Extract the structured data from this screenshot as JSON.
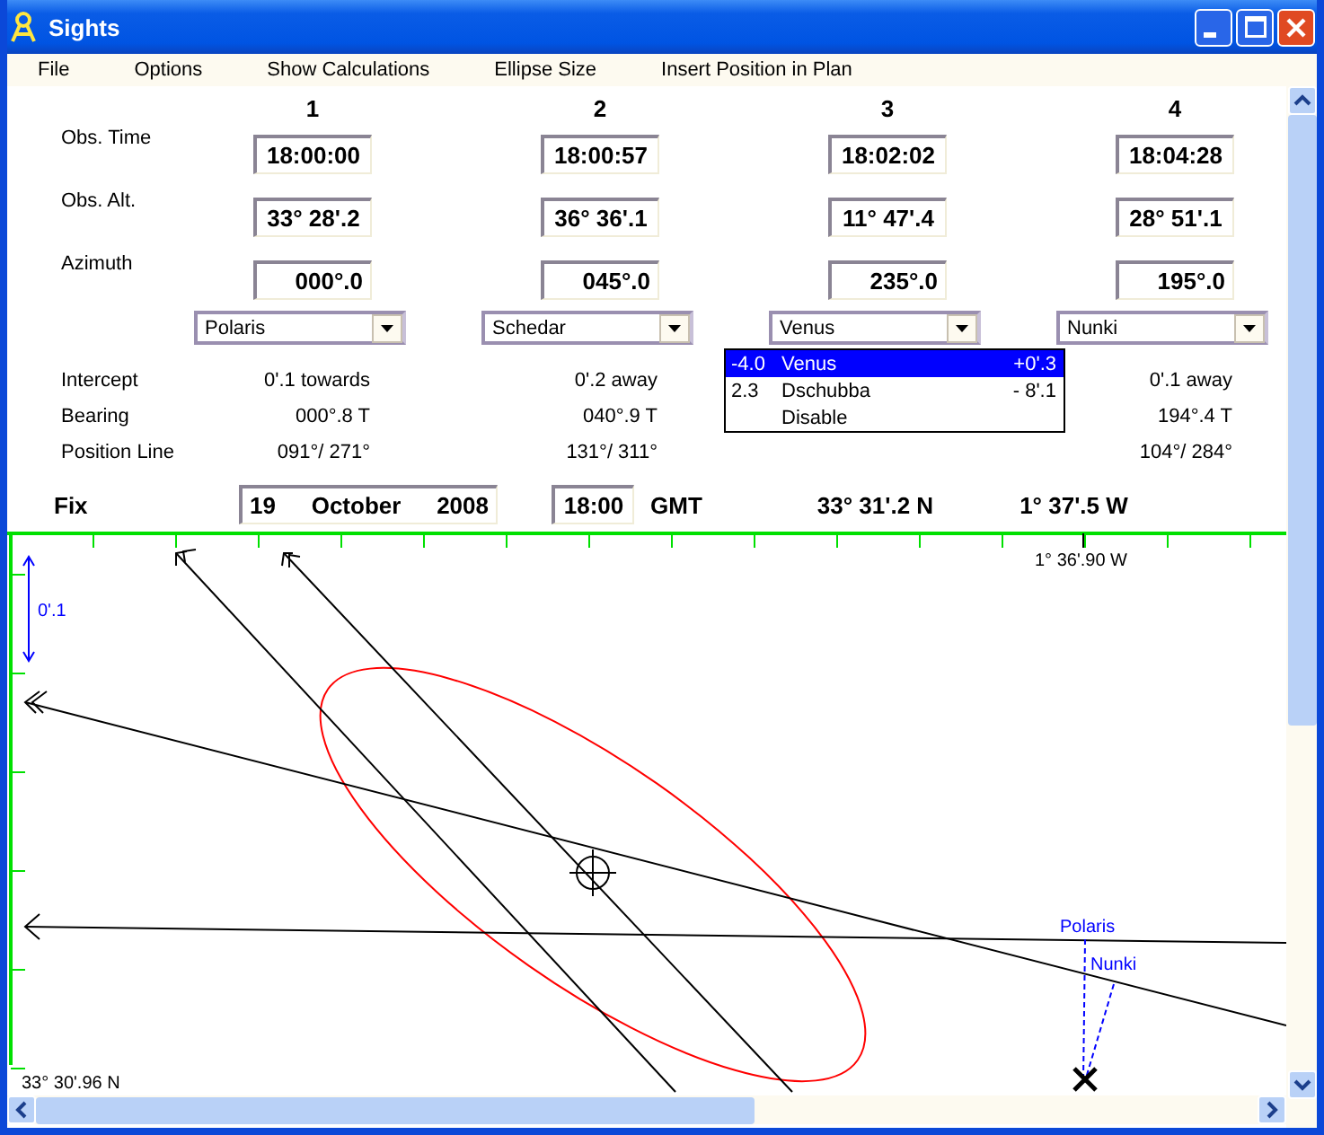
{
  "window": {
    "title": "Sights"
  },
  "menu": [
    "File",
    "Options",
    "Show Calculations",
    "Ellipse Size",
    "Insert Position in Plan"
  ],
  "row_labels": {
    "time": "Obs. Time",
    "alt": "Obs. Alt.",
    "azimuth": "Azimuth",
    "intercept": "Intercept",
    "bearing": "Bearing",
    "position_line": "Position Line"
  },
  "sights": [
    {
      "number": "1",
      "time": "18:00:00",
      "alt": "33° 28'.2",
      "azimuth": "000°.0",
      "body": "Polaris",
      "intercept": "0'.1 towards",
      "bearing": "000°.8 T",
      "position_line": "091°/ 271°"
    },
    {
      "number": "2",
      "time": "18:00:57",
      "alt": "36° 36'.1",
      "azimuth": "045°.0",
      "body": "Schedar",
      "intercept": "0'.2 away",
      "bearing": "040°.9 T",
      "position_line": "131°/ 311°"
    },
    {
      "number": "3",
      "time": "18:02:02",
      "alt": "11° 47'.4",
      "azimuth": "235°.0",
      "body": "Venus",
      "dropdown_open": true,
      "options": [
        {
          "magnitude": "-4.0",
          "name": "Venus",
          "offset": "+0'.3",
          "selected": true
        },
        {
          "magnitude": "2.3",
          "name": "Dschubba",
          "offset": "- 8'.1",
          "selected": false
        },
        {
          "name": "Disable",
          "selected": false
        }
      ]
    },
    {
      "number": "4",
      "time": "18:04:28",
      "alt": "28° 51'.1",
      "azimuth": "195°.0",
      "body": "Nunki",
      "intercept": "0'.1 away",
      "bearing": "194°.4 T",
      "position_line": "104°/ 284°"
    }
  ],
  "fix": {
    "label": "Fix",
    "day": "19",
    "month": "October",
    "year": "2008",
    "time": "18:00",
    "zone": "GMT",
    "latitude": "33° 31'.2 N",
    "longitude": "1° 37'.5 W"
  },
  "plot": {
    "scale": "0'.1",
    "longitude_label": "1° 36'.90 W",
    "latitude_label": "33° 30'.96 N",
    "body_labels": [
      "Polaris",
      "Nunki"
    ]
  }
}
